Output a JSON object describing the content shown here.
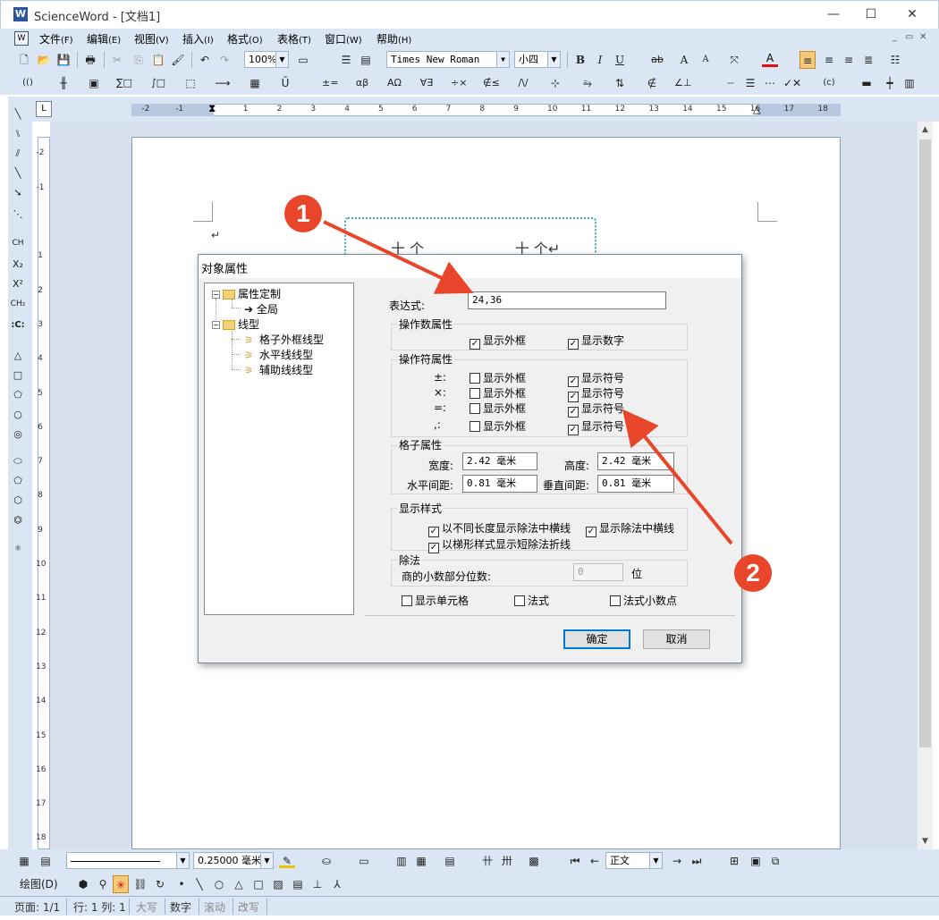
{
  "window": {
    "title": "ScienceWord - [文档1]",
    "app_icon": "W",
    "controls": [
      "—",
      "☐",
      "✕"
    ]
  },
  "menu": {
    "items": [
      {
        "label": "文件",
        "key": "(F)"
      },
      {
        "label": "编辑",
        "key": "(E)"
      },
      {
        "label": "视图",
        "key": "(V)"
      },
      {
        "label": "插入",
        "key": "(I)"
      },
      {
        "label": "格式",
        "key": "(O)"
      },
      {
        "label": "表格",
        "key": "(T)"
      },
      {
        "label": "窗口",
        "key": "(W)"
      },
      {
        "label": "帮助",
        "key": "(H)"
      }
    ],
    "mdi_controls": [
      "_",
      "▭",
      "✕"
    ]
  },
  "toolbar1": {
    "zoom": "100%",
    "font": "Times New Roman",
    "size": "小四",
    "bold": "B",
    "italic": "I",
    "underline": "U",
    "strike": "ab",
    "grow": "A",
    "shrink": "A",
    "font_color_label": "A"
  },
  "toolbar2": {
    "labels": [
      "(()",
      "∑□",
      "∫□",
      "±=",
      "αβ",
      "ΑΩ",
      "∀∃",
      "÷×",
      "∉≤",
      "/\\/",
      "∠⊥",
      "(c)"
    ]
  },
  "ruler": {
    "h_ticks": [
      "-2",
      "-1",
      "1",
      "2",
      "3",
      "4",
      "5",
      "6",
      "7",
      "8",
      "9",
      "10",
      "11",
      "12",
      "13",
      "14",
      "15",
      "16",
      "17",
      "18"
    ],
    "v_ticks": [
      "-2",
      "-1",
      "1",
      "2",
      "3",
      "4",
      "5",
      "6",
      "7",
      "8",
      "9",
      "10",
      "11",
      "12",
      "13",
      "14",
      "15",
      "16",
      "17",
      "18"
    ]
  },
  "document": {
    "paragraph_mark": "↵",
    "text_line": "十 个                    十 个↵"
  },
  "dialog": {
    "title": "对象属性",
    "tree": {
      "root1": "属性定制",
      "root1_child": "全局",
      "root2": "线型",
      "root2_children": [
        "格子外框线型",
        "水平线线型",
        "辅助线线型"
      ]
    },
    "expression_label": "表达式:",
    "expression_value": "24,36",
    "operand_group": "操作数属性",
    "operand_show_border": "显示外框",
    "operand_show_digits": "显示数字",
    "operator_group": "操作符属性",
    "operators": [
      {
        "symbol": "±:",
        "border": "显示外框",
        "sym": "显示符号",
        "border_checked": false,
        "sym_checked": true
      },
      {
        "symbol": "×:",
        "border": "显示外框",
        "sym": "显示符号",
        "border_checked": false,
        "sym_checked": true
      },
      {
        "symbol": "=:",
        "border": "显示外框",
        "sym": "显示符号",
        "border_checked": false,
        "sym_checked": true
      },
      {
        "symbol": ",:",
        "border": "显示外框",
        "sym": "显示符号",
        "border_checked": false,
        "sym_checked": true
      }
    ],
    "cell_group": "格子属性",
    "width_label": "宽度:",
    "width_value": "2.42 毫米",
    "height_label": "高度:",
    "height_value": "2.42 毫米",
    "hgap_label": "水平间距:",
    "hgap_value": "0.81 毫米",
    "vgap_label": "垂直间距:",
    "vgap_value": "0.81 毫米",
    "style_group": "显示样式",
    "style_opt1": "以不同长度显示除法中横线",
    "style_opt2": "显示除法中横线",
    "style_opt3": "以梯形样式显示短除法折线",
    "division_group": "除法",
    "decimals_label": "商的小数部分位数:",
    "decimals_value": "0",
    "decimals_unit": "位",
    "show_cells": "显示单元格",
    "formula": "法式",
    "formula_decimal": "法式小数点",
    "ok": "确定",
    "cancel": "取消"
  },
  "bottom_toolbar1": {
    "line_width": "0.25000 毫米·",
    "style": "正文"
  },
  "bottom_toolbar2": {
    "draw_label": "绘图(D)"
  },
  "statusbar": {
    "page": "页面: 1/1",
    "rowcol": "行: 1 列: 1",
    "caps": "大写",
    "num": "数字",
    "scroll": "滚动",
    "overwrite": "改写"
  },
  "annotations": {
    "badge1": "1",
    "badge2": "2",
    "color": "#e8452a"
  }
}
